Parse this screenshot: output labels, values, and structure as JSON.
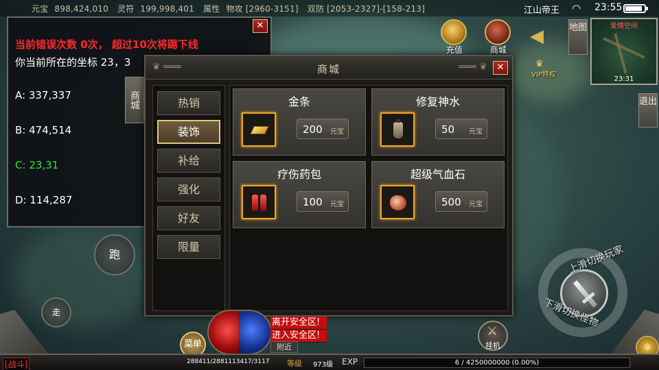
{
  "status_bar": {
    "currency_label": "元宝",
    "currency_value": "898,424,010",
    "spirit_label": "灵符",
    "spirit_value": "199,998,401",
    "attr_label": "属性",
    "phys_atk": "物攻 [2960-3151]",
    "dual_def": "双防 [2053-2327]-[158-213]",
    "server": "江山帝王",
    "time": "23:55",
    "battery_level": 0.9
  },
  "info_panel": {
    "warning": "当前错误次数 0次， 超过10次将踢下线",
    "coord_prefix": "你当前所在的坐标 23，3",
    "points": [
      {
        "label": "A:",
        "value": "337,337",
        "highlight": false
      },
      {
        "label": "B:",
        "value": "474,514",
        "highlight": false
      },
      {
        "label": "C:",
        "value": "23,31",
        "highlight": true
      },
      {
        "label": "D:",
        "value": "114,287",
        "highlight": false
      }
    ],
    "close_label": "✕",
    "side_tab": "商城"
  },
  "shop": {
    "title": "商城",
    "close_label": "✕",
    "tabs": [
      {
        "label": "热销",
        "active": false
      },
      {
        "label": "装饰",
        "active": true
      },
      {
        "label": "补给",
        "active": false
      },
      {
        "label": "强化",
        "active": false
      },
      {
        "label": "好友",
        "active": false
      },
      {
        "label": "限量",
        "active": false
      }
    ],
    "items": [
      {
        "name": "金条",
        "price": "200",
        "currency": "元宝",
        "icon": "gold-bar-icon"
      },
      {
        "name": "修复神水",
        "price": "50",
        "currency": "元宝",
        "icon": "repair-potion-icon"
      },
      {
        "name": "疗伤药包",
        "price": "100",
        "currency": "元宝",
        "icon": "healing-pack-icon"
      },
      {
        "name": "超级气血石",
        "price": "500",
        "currency": "元宝",
        "icon": "blood-stone-icon"
      }
    ]
  },
  "right_menu": {
    "recharge": "充值",
    "mall": "商城",
    "map": "地图",
    "vip": "VIP特权",
    "exit": "退出",
    "minimap_name": "爱情空间",
    "minimap_time": "23:31"
  },
  "controls": {
    "run": "跑",
    "walk": "走",
    "attack_top": "上滑切换玩家",
    "attack_bottom": "下滑切换怪物",
    "hang": "挂机",
    "menu": "菜单"
  },
  "chat": {
    "lines": [
      "离开安全区!",
      "进入安全区!"
    ],
    "tab": "附近"
  },
  "bottom": {
    "battle_tag": "[战斗]",
    "hp_mp": "288411/2881113417/3117",
    "level_label": "等级",
    "level_value": "973级",
    "exp_label": "EXP",
    "exp_text": "6 / 4250000000 (0.00%)"
  }
}
